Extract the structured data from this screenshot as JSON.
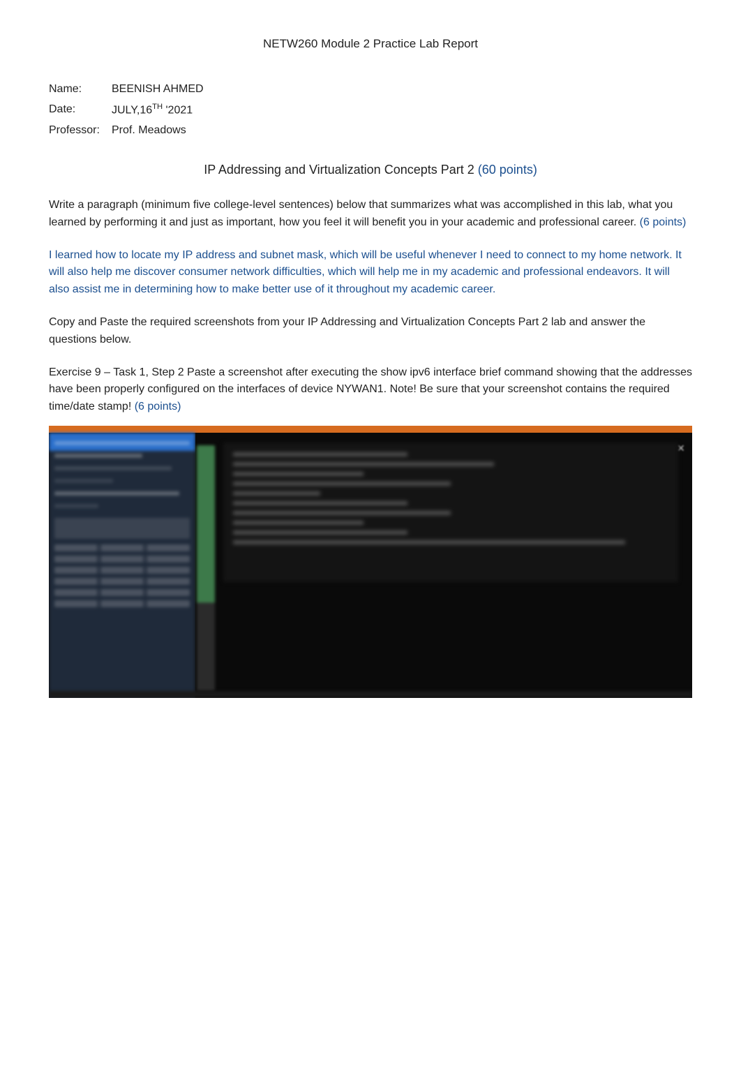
{
  "header": {
    "title": "NETW260 Module 2 Practice Lab Report"
  },
  "meta": {
    "name_label": "Name:",
    "name_value": "BEENISH AHMED",
    "date_label": "Date:",
    "date_prefix": "JULY,16",
    "date_sup": "TH",
    "date_suffix": " '2021",
    "prof_label": "Professor:",
    "prof_value": "Prof. Meadows"
  },
  "section": {
    "title_text": "IP Addressing and Virtualization Concepts Part 2 ",
    "title_points": "(60 points)"
  },
  "prompt": {
    "text": "Write a paragraph (minimum five college-level sentences) below that summarizes what was accomplished in this lab, what you learned by performing it and just as important, how you feel it will benefit you in your academic and professional career.   ",
    "points": "(6 points)"
  },
  "answer": {
    "text": "I learned how to locate my IP address and subnet mask, which will be useful whenever I need to connect to my home network. It will also help me discover consumer network difficulties, which will help me in my academic and professional endeavors. It will also assist me in determining how to make better use of it throughout my academic career."
  },
  "instruction2": {
    "pre": "Copy and Paste the required screenshots from your ",
    "bold": "IP Addressing and Virtualization Concepts Part 2",
    "post": " lab and answer the questions below."
  },
  "exercise": {
    "text": "Exercise 9 – Task 1, Step 2 Paste a screenshot after executing the show ipv6 interface brief command showing that the addresses have been properly configured on the interfaces of device NYWAN1. Note! Be sure that your screenshot contains the required time/date stamp! ",
    "points": "(6 points)"
  },
  "screenshot": {
    "close_glyph": "✕"
  }
}
